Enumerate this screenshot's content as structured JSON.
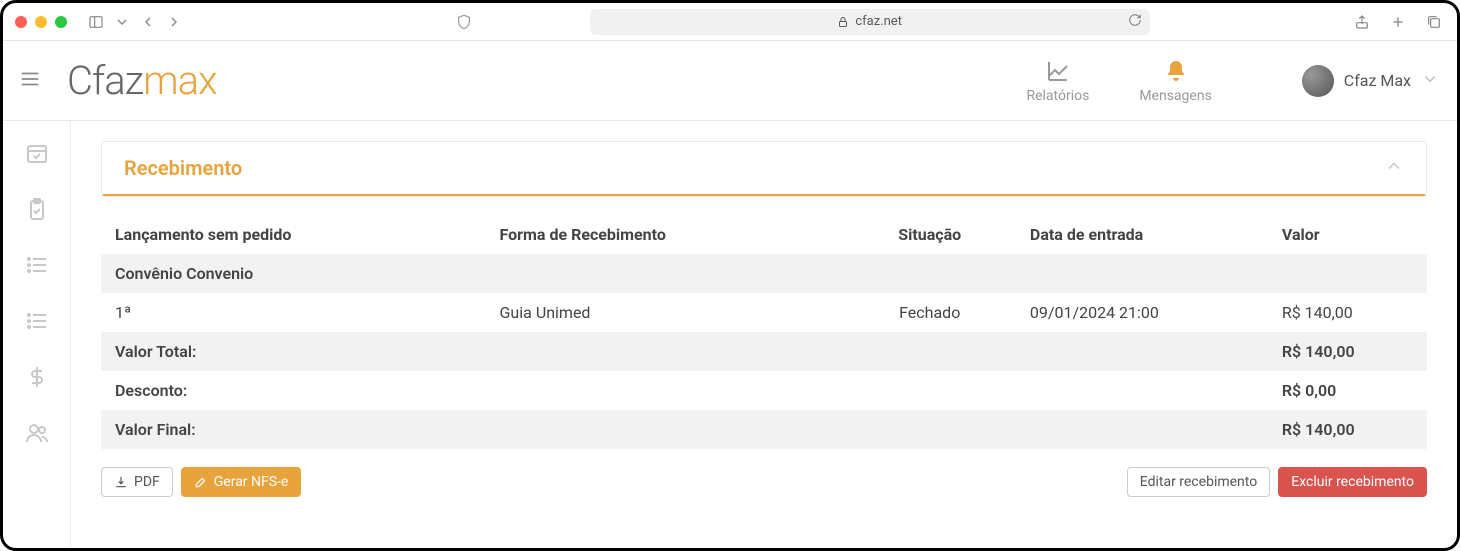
{
  "browser": {
    "url": "cfaz.net"
  },
  "logo": {
    "part1": "Cfaz",
    "part2": "max"
  },
  "header": {
    "nav": {
      "reports": "Relatórios",
      "messages": "Mensagens"
    },
    "user_name": "Cfaz Max"
  },
  "panel": {
    "title": "Recebimento"
  },
  "table": {
    "headers": {
      "lancamento": "Lançamento sem pedido",
      "forma": "Forma de Recebimento",
      "situacao": "Situação",
      "data": "Data de entrada",
      "valor": "Valor"
    },
    "group_label": "Convênio Convenio",
    "row": {
      "seq": "1ª",
      "forma": "Guia Unimed",
      "situacao": "Fechado",
      "data": "09/01/2024 21:00",
      "valor": "R$ 140,00"
    },
    "totals": {
      "total_label": "Valor Total:",
      "total_value": "R$ 140,00",
      "desconto_label": "Desconto:",
      "desconto_value": "R$ 0,00",
      "final_label": "Valor Final:",
      "final_value": "R$ 140,00"
    }
  },
  "buttons": {
    "pdf": "PDF",
    "nfse": "Gerar NFS-e",
    "edit": "Editar recebimento",
    "delete": "Excluir recebimento"
  }
}
